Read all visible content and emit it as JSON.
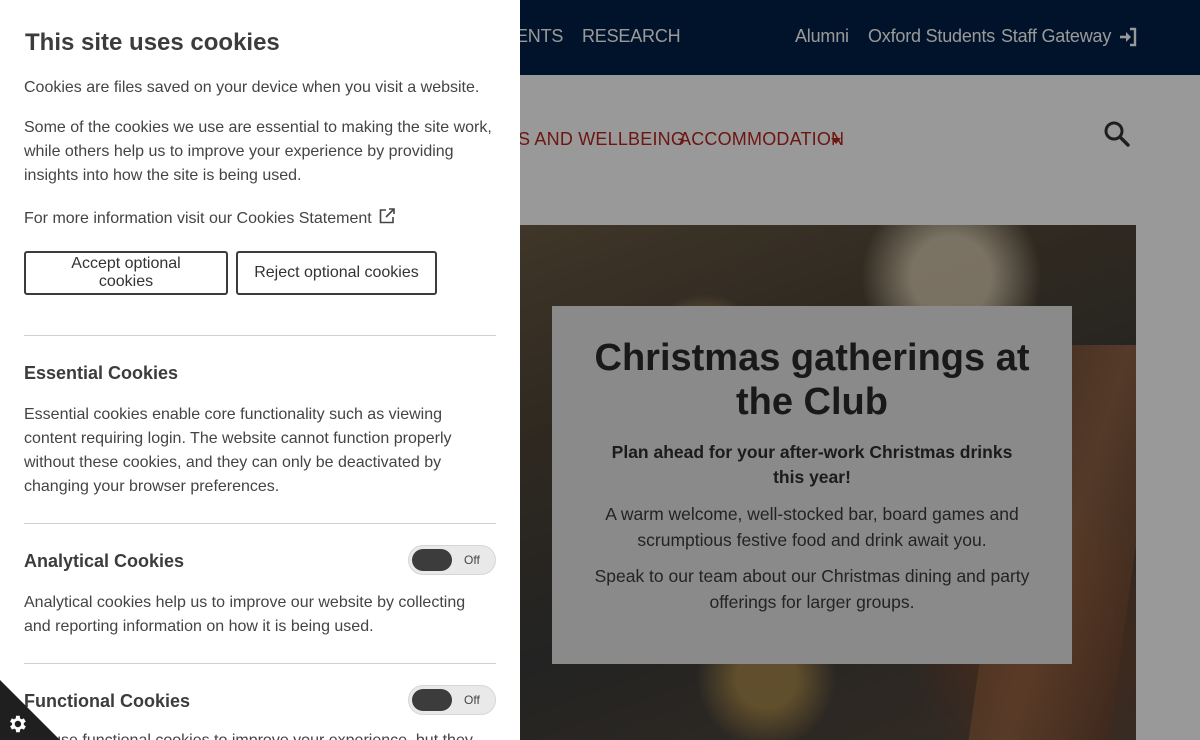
{
  "topbar": {
    "links": [
      "ENTS",
      "RESEARCH",
      "Alumni",
      "Oxford Students",
      "Staff Gateway"
    ],
    "login_icon": "sign-in-icon"
  },
  "main_nav": {
    "links": [
      "S AND WELLBEING",
      "ACCOMMODATION"
    ],
    "search_icon": "search-icon"
  },
  "hero": {
    "title": "Christmas gatherings at the Club",
    "subtitle": "Plan ahead for your after-work Christmas drinks this year!",
    "text1": "A warm welcome, well-stocked bar, board games and scrumptious festive food and drink await you.",
    "text2": "Speak to our team about our Christmas dining and party offerings for larger groups."
  },
  "cookie_panel": {
    "title": "This site uses cookies",
    "intro": "Cookies are files saved on your device when you visit a website.",
    "body": "Some of the cookies we use are essential to making the site work, while others help us to improve your experience by providing insights into how the site is being used.",
    "more_info": "For more information visit our Cookies Statement",
    "accept_label": "Accept optional cookies",
    "reject_label": "Reject optional cookies",
    "essential_title": "Essential Cookies",
    "essential_text": "Essential cookies enable core functionality such as viewing content requiring login. The website cannot function properly without these cookies, and they can only be deactivated by changing your browser preferences.",
    "analytical_title": "Analytical Cookies",
    "analytical_toggle": "Off",
    "analytical_text": "Analytical cookies help us to improve our website by collecting and reporting information on how it is being used.",
    "functional_title": "Functional Cookies",
    "functional_toggle": "Off",
    "functional_text_partial": "We use functional cookies to improve your experience, but they"
  },
  "colors": {
    "topbar_bg": "#002147",
    "nav_red": "#b5261e",
    "panel_text": "#3c3c3c"
  }
}
